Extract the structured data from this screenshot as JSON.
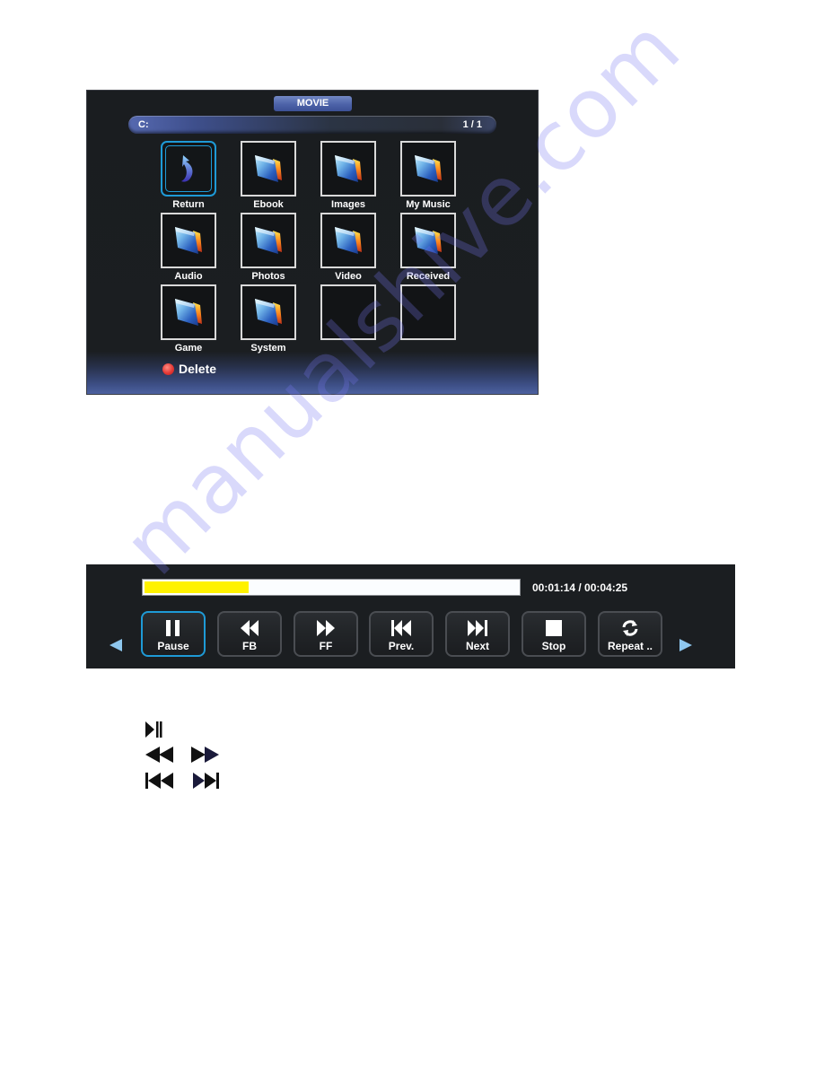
{
  "browser": {
    "title": "MOVIE",
    "path": "C:",
    "page_indicator": "1 / 1",
    "items": [
      {
        "label": "Return",
        "icon": "return-arrow-icon",
        "selected": true
      },
      {
        "label": "Ebook",
        "icon": "folder-icon"
      },
      {
        "label": "Images",
        "icon": "folder-icon"
      },
      {
        "label": "My Music",
        "icon": "folder-icon"
      },
      {
        "label": "Audio",
        "icon": "folder-icon"
      },
      {
        "label": "Photos",
        "icon": "folder-icon"
      },
      {
        "label": "Video",
        "icon": "folder-icon"
      },
      {
        "label": "Received",
        "icon": "folder-icon"
      },
      {
        "label": "Game",
        "icon": "folder-icon"
      },
      {
        "label": "System",
        "icon": "folder-icon"
      },
      {
        "label": "",
        "icon": "empty-slot"
      },
      {
        "label": "",
        "icon": "empty-slot"
      }
    ],
    "delete_hint": {
      "label": "Delete",
      "color": "#e53935"
    }
  },
  "player": {
    "progress_fraction": 0.28,
    "elapsed": "00:01:14",
    "total": "00:04:25",
    "time_text": "00:01:14 / 00:04:25",
    "controls": [
      {
        "label": "Pause",
        "icon": "pause-icon",
        "active": true
      },
      {
        "label": "FB",
        "icon": "fast-backward-icon"
      },
      {
        "label": "FF",
        "icon": "fast-forward-icon"
      },
      {
        "label": "Prev.",
        "icon": "previous-track-icon"
      },
      {
        "label": "Next",
        "icon": "next-track-icon"
      },
      {
        "label": "Stop",
        "icon": "stop-icon"
      },
      {
        "label": "Repeat ..",
        "icon": "repeat-icon"
      }
    ],
    "accent_color": "#1e9ad6",
    "progress_color": "#fff200"
  },
  "legend_icons": [
    "play-pause-icon",
    "rewind-icon",
    "fast-forward-icon",
    "skip-previous-icon",
    "skip-next-icon"
  ],
  "watermark": "manualshive.com"
}
